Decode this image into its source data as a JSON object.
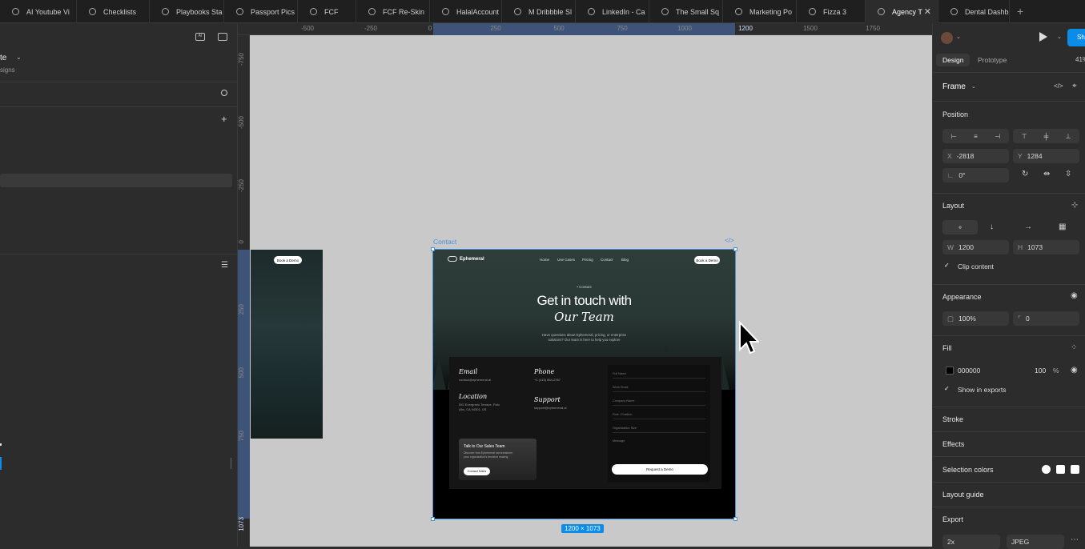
{
  "tabs": [
    {
      "label": "AI Youtube Vi"
    },
    {
      "label": "Checklists"
    },
    {
      "label": "Playbooks Sta"
    },
    {
      "label": "Passport Pics"
    },
    {
      "label": "FCF"
    },
    {
      "label": "FCF Re-Skin"
    },
    {
      "label": "HalalAccount"
    },
    {
      "label": "M Dribbble Sl"
    },
    {
      "label": "LinkedIn - Ca"
    },
    {
      "label": "The Small Sq"
    },
    {
      "label": "Marketing Po"
    },
    {
      "label": "Fizza 3"
    },
    {
      "label": "Agency T"
    },
    {
      "label": "Dental Dashb"
    }
  ],
  "left": {
    "title_frag": "te",
    "subtitle_frag": "signs"
  },
  "rulers": {
    "top": [
      "-500",
      "-250",
      "0",
      "250",
      "500",
      "750",
      "1000",
      "1200",
      "1500",
      "1750"
    ],
    "left": [
      "-750",
      "-500",
      "-250",
      "0",
      "250",
      "500",
      "750",
      "1073"
    ]
  },
  "canvas": {
    "frame_label": "Contact",
    "size_badge": "1200 × 1073",
    "small_frame_button": "Book a Demo"
  },
  "site": {
    "brand": "Ephemeral",
    "nav": [
      "Home",
      "Use Cases",
      "Pricing",
      "Contact",
      "Blog"
    ],
    "cta": "Book a Demo",
    "breadcrumb": "• Contact",
    "headline": "Get in touch with",
    "headline_italic": "Our Team",
    "sub1": "Have questions about Ephemeral, pricing, or enterprise",
    "sub2": "solutions? Our team is here to help you explore",
    "email_h": "Email",
    "email_v": "contact@ephemeral.ai",
    "phone_h": "Phone",
    "phone_v": "+1 (415) 864-2397",
    "loc_h": "Location",
    "loc_v1": "552 Evergreen Terrace, Palo",
    "loc_v2": "Alto, CA 94301, US",
    "support_h": "Support",
    "support_v": "support@ephemeral.ai",
    "sales_title": "Talk to Our Sales Team",
    "sales_d1": "Discover how Ephemeral can transform",
    "sales_d2": "your organization's decision making.",
    "sales_btn": "Contact Sales",
    "form_fields": [
      "Full Name",
      "Work Email",
      "Company Name",
      "Role / Position",
      "Organization Size",
      "Message"
    ],
    "submit": "Request a Demo"
  },
  "right": {
    "tab_design": "Design",
    "tab_prototype": "Prototype",
    "zoom": "41%",
    "share": "Share",
    "frame": "Frame",
    "position": "Position",
    "x_label": "X",
    "x": "-2818",
    "y_label": "Y",
    "y": "1284",
    "rot": "0°",
    "layout": "Layout",
    "w_label": "W",
    "w": "1200",
    "h_label": "H",
    "h": "1073",
    "clip": "Clip content",
    "appearance": "Appearance",
    "opacity": "100%",
    "radius": "0",
    "fill": "Fill",
    "fill_hex": "000000",
    "fill_pct": "100",
    "pct": "%",
    "show_exports": "Show in exports",
    "stroke": "Stroke",
    "effects": "Effects",
    "selection_colors": "Selection colors",
    "layout_guide": "Layout guide",
    "export": "Export",
    "scale": "2x",
    "format": "JPEG"
  },
  "colors": {
    "accent": "#0c8ce9",
    "selection": "#4a90d9"
  }
}
